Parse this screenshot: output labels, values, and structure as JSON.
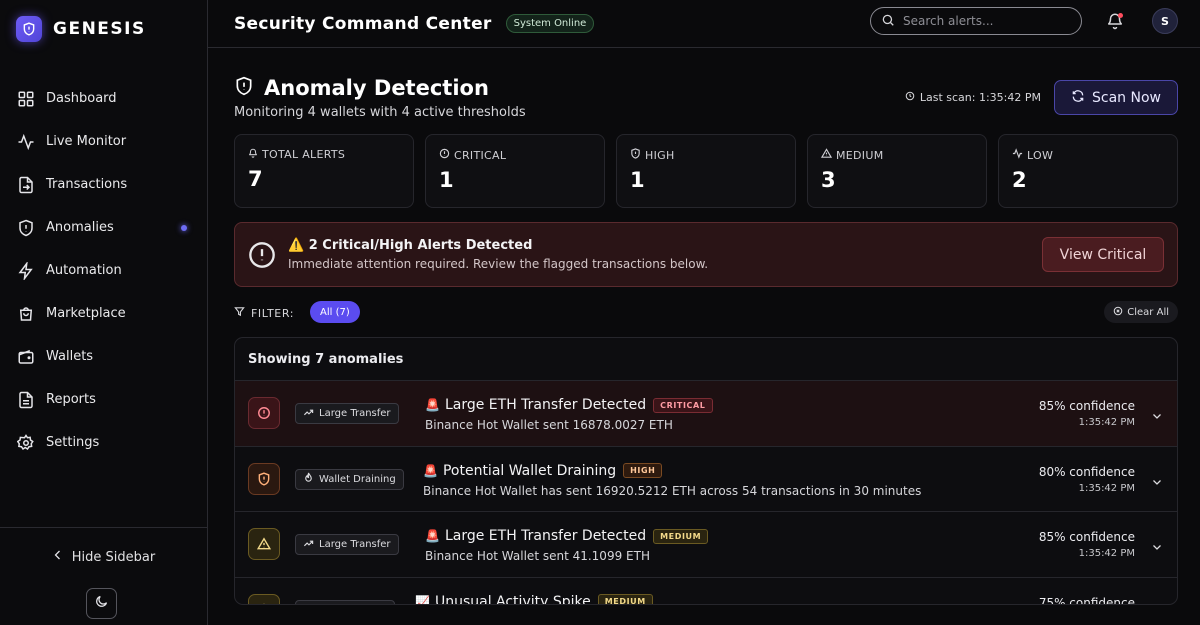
{
  "brand": {
    "name": "GENESIS"
  },
  "sidebar": {
    "items": [
      {
        "label": "Dashboard",
        "icon": "grid-icon"
      },
      {
        "label": "Live Monitor",
        "icon": "activity-icon"
      },
      {
        "label": "Transactions",
        "icon": "file-transfer-icon"
      },
      {
        "label": "Anomalies",
        "icon": "alert-shield-icon",
        "active_dot": true
      },
      {
        "label": "Automation",
        "icon": "bolt-icon"
      },
      {
        "label": "Marketplace",
        "icon": "bag-icon"
      },
      {
        "label": "Wallets",
        "icon": "wallet-icon"
      },
      {
        "label": "Reports",
        "icon": "report-icon"
      },
      {
        "label": "Settings",
        "icon": "gear-icon"
      }
    ],
    "hide_label": "Hide Sidebar"
  },
  "topbar": {
    "title": "Security Command Center",
    "status_badge": "System Online",
    "search_placeholder": "Search alerts...",
    "avatar_initial": "S"
  },
  "header": {
    "title": "Anomaly Detection",
    "subtitle": "Monitoring 4 wallets with 4 active thresholds",
    "last_scan": "Last scan: 1:35:42 PM",
    "scan_button": "Scan Now"
  },
  "stats": [
    {
      "label": "TOTAL ALERTS",
      "value": "7",
      "icon": "bell-icon"
    },
    {
      "label": "CRITICAL",
      "value": "1",
      "icon": "alert-circle-icon"
    },
    {
      "label": "HIGH",
      "value": "1",
      "icon": "shield-icon"
    },
    {
      "label": "MEDIUM",
      "value": "3",
      "icon": "warning-triangle-icon"
    },
    {
      "label": "LOW",
      "value": "2",
      "icon": "activity-icon"
    }
  ],
  "banner": {
    "title": "⚠️ 2 Critical/High Alerts Detected",
    "subtitle": "Immediate attention required. Review the flagged transactions below.",
    "button": "View Critical"
  },
  "filter": {
    "label": "FILTER:",
    "chip_all": "All (7)",
    "clear_all": "Clear All"
  },
  "list": {
    "count_label": "Showing 7 anomalies",
    "rows": [
      {
        "severity": "critical",
        "type": "Large Transfer",
        "emoji": "🚨",
        "title": "Large ETH Transfer Detected",
        "badge": "CRITICAL",
        "desc": "Binance Hot Wallet sent 16878.0027 ETH",
        "confidence": "85% confidence",
        "time": "1:35:42 PM"
      },
      {
        "severity": "high",
        "type": "Wallet Draining",
        "emoji": "🚨",
        "title": "Potential Wallet Draining",
        "badge": "HIGH",
        "desc": "Binance Hot Wallet has sent 16920.5212 ETH across 54 transactions in 30 minutes",
        "confidence": "80% confidence",
        "time": "1:35:42 PM"
      },
      {
        "severity": "medium",
        "type": "Large Transfer",
        "emoji": "🚨",
        "title": "Large ETH Transfer Detected",
        "badge": "MEDIUM",
        "desc": "Binance Hot Wallet sent 41.1099 ETH",
        "confidence": "85% confidence",
        "time": "1:35:42 PM"
      },
      {
        "severity": "medium",
        "type": "Activity Spike",
        "emoji": "📈",
        "title": "Unusual Activity Spike",
        "badge": "MEDIUM",
        "desc": "",
        "confidence": "75% confidence",
        "time": ""
      }
    ]
  },
  "colors": {
    "accent": "#5b4cf0",
    "critical": "#ff5a66",
    "high": "#ff9a4a",
    "medium": "#f2c94c"
  }
}
